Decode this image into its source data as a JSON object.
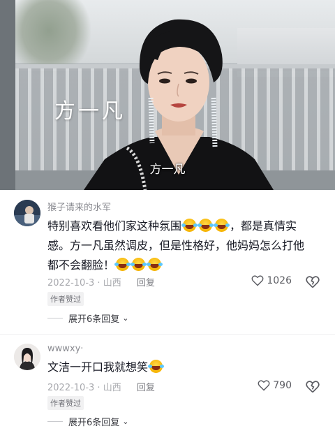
{
  "video": {
    "overlay_name": "方一凡",
    "subtitle": "方一凡"
  },
  "comments": [
    {
      "username": "猴子请来的水军",
      "text_parts": [
        "特别喜欢看他们家这种氛围",
        "，都是真情实感。方一凡虽然调皮，但是性格好，他妈妈怎么打他都不会翻脸！"
      ],
      "date": "2022-10-3",
      "location": "山西",
      "reply_label": "回复",
      "author_liked": "作者赞过",
      "likes": "1026",
      "expand_label": "展开6条回复"
    },
    {
      "username": "wwwxy·",
      "text": "文洁一开口我就想笑",
      "date": "2022-10-3",
      "location": "山西",
      "reply_label": "回复",
      "author_liked": "作者赞过",
      "likes": "790",
      "expand_label": "展开6条回复"
    }
  ],
  "icons": {
    "emoji": "laugh-cry-emoji",
    "like": "heart-outline-icon",
    "dislike": "broken-heart-icon",
    "expand": "chevron-down-icon"
  },
  "colors": {
    "text_primary": "#161823",
    "text_secondary": "#8a8b91",
    "meta": "#a7a8ad"
  }
}
